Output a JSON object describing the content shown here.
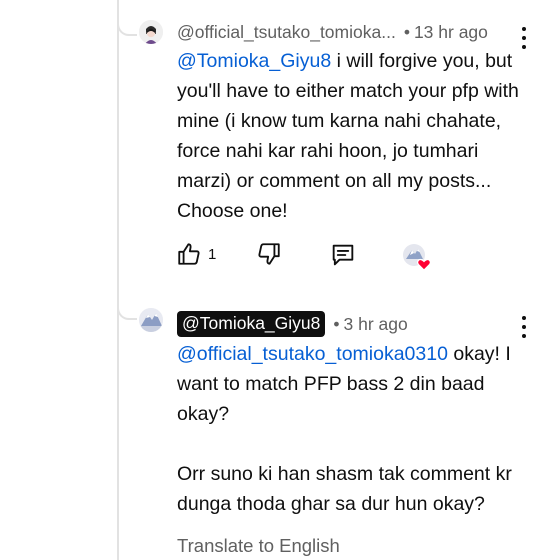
{
  "comments": [
    {
      "author": "@official_tsutako_tomioka...",
      "separator": "•",
      "time": "13 hr ago",
      "mention": "@Tomioka_Giyu8",
      "text": " i will forgive you, but you'll have to either match your pfp with mine (i know tum karna nahi chahate, force nahi kar rahi hoon, jo tumhari marzi) or comment on all my posts... Choose one!",
      "like_count": "1",
      "icons": {
        "like": "thumbs-up-icon",
        "dislike": "thumbs-down-icon",
        "reply": "reply-icon",
        "creator_heart": "creator-heart-icon",
        "more": "more-vert-icon"
      },
      "colors": {
        "heart": "#ff0033"
      }
    },
    {
      "author": "@Tomioka_Giyu8",
      "separator": "•",
      "time": "3 hr ago",
      "mention": "@official_tsutako_tomioka0310",
      "text_line_1": " okay! I want to match PFP bass 2 din baad okay?",
      "text_line_2": "Orr suno ki han shasm tak comment kr dunga thoda ghar sa dur hun okay?",
      "translate": "Translate to English",
      "icons": {
        "more": "more-vert-icon"
      }
    }
  ],
  "colors": {
    "link": "#065fd4",
    "meta": "#606060",
    "text": "#0f0f0f",
    "pill_bg": "#0f0f0f"
  }
}
